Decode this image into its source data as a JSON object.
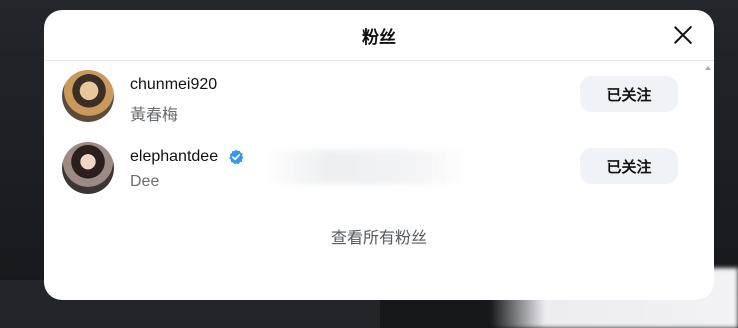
{
  "modal": {
    "title": "粉丝",
    "view_all_label": "查看所有粉丝"
  },
  "followers": [
    {
      "username": "chunmei920",
      "display_name": "黃春梅",
      "verified": false,
      "button_label": "已关注"
    },
    {
      "username": "elephantdee",
      "display_name": "Dee",
      "verified": true,
      "button_label": "已关注"
    }
  ],
  "colors": {
    "verified_badge": "#3897f0",
    "button_bg": "#eff2f7",
    "secondary_text": "#6a6d72"
  },
  "icons": {
    "close": "close-icon",
    "verified": "verified-badge-icon",
    "scroll_up": "scroll-up-arrow-icon"
  }
}
